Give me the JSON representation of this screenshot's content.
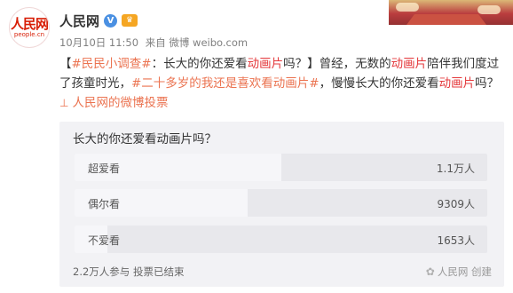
{
  "header": {
    "username": "人民网",
    "meta_date": "10月10日 11:50",
    "meta_from": "来自 微博 weibo.com",
    "avatar_logo_cn": "人民网",
    "avatar_logo_en": "people.cn"
  },
  "post": {
    "topic1": "#民民小调查#",
    "bracket_open": "【",
    "text_a": "：长大的你还爱看",
    "kw1": "动画片",
    "text_b": "吗？】曾经，无数的",
    "kw2": "动画片",
    "text_c": "陪伴我们度过了孩童时光，",
    "topic2": "#二十多岁的我还是喜欢看动画片#",
    "text_d": "，慢慢长大的你还爱看",
    "kw3": "动画片",
    "text_e": "吗？",
    "vote_link": "人民网的微博投票"
  },
  "poll": {
    "title": "长大的你还爱看动画片吗？",
    "options": [
      {
        "label": "超爱看",
        "count": "1.1万人",
        "share": 0.5
      },
      {
        "label": "偶尔看",
        "count": "9309人",
        "share": 0.42
      },
      {
        "label": "不爱看",
        "count": "1653人",
        "share": 0.08
      }
    ],
    "footer": "2.2万人参与 投票已结束",
    "creator": "人民网 创建"
  },
  "colors": {
    "accent_link": "#eb7350",
    "keyword": "#e4393c",
    "verify": "#4a90e2"
  }
}
